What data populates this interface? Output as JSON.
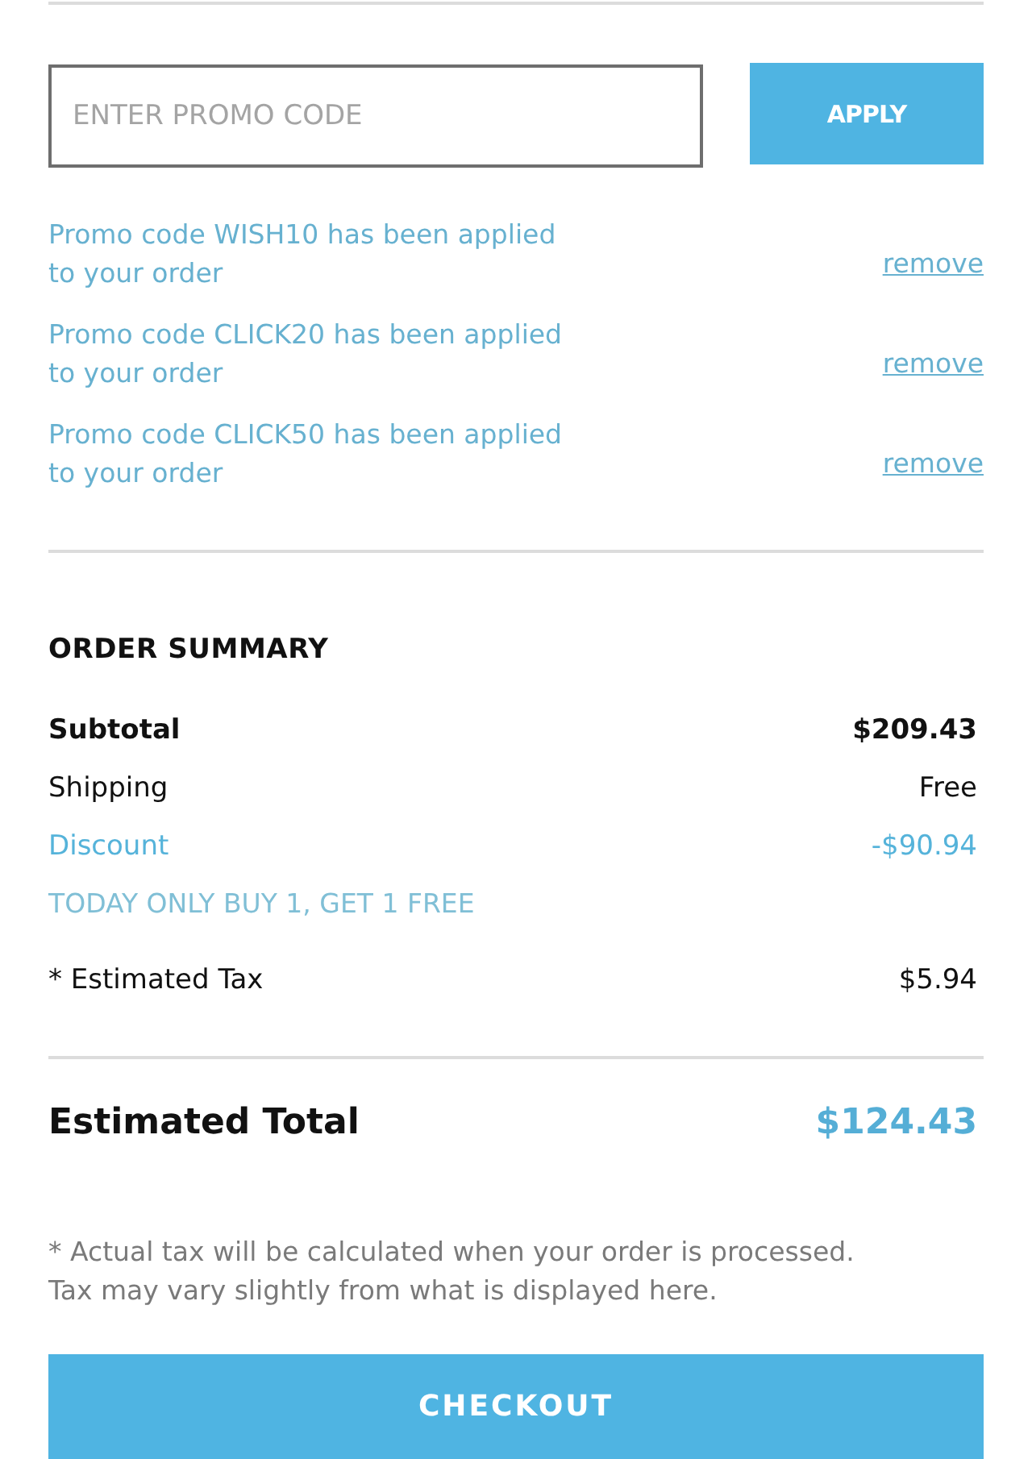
{
  "promo_form": {
    "placeholder": "ENTER PROMO CODE",
    "apply_button": "APPLY"
  },
  "applied_promos": [
    {
      "message": "Promo code WISH10 has been applied to your order",
      "remove_link": "remove"
    },
    {
      "message": "Promo code CLICK20 has been applied to your order",
      "remove_link": "remove"
    },
    {
      "message": "Promo code CLICK50 has been applied to your order",
      "remove_link": "remove"
    }
  ],
  "order_summary": {
    "title": "ORDER SUMMARY",
    "rows": [
      {
        "kind": "subtotal",
        "label": "Subtotal",
        "value": "$209.43"
      },
      {
        "kind": "line",
        "label": "Shipping",
        "value": "Free"
      },
      {
        "kind": "discount",
        "label": "Discount",
        "value": "-$90.94"
      },
      {
        "kind": "promo_note",
        "label": "TODAY ONLY BUY 1, GET 1 FREE"
      },
      {
        "kind": "tax",
        "label": "* Estimated Tax",
        "value": "$5.94"
      }
    ]
  },
  "total": {
    "label": "Estimated Total",
    "value": "$124.43"
  },
  "tax_note": "* Actual tax will be calculated when your order is processed. Tax may vary slightly from what is displayed here.",
  "checkout_button": "CHECKOUT"
}
